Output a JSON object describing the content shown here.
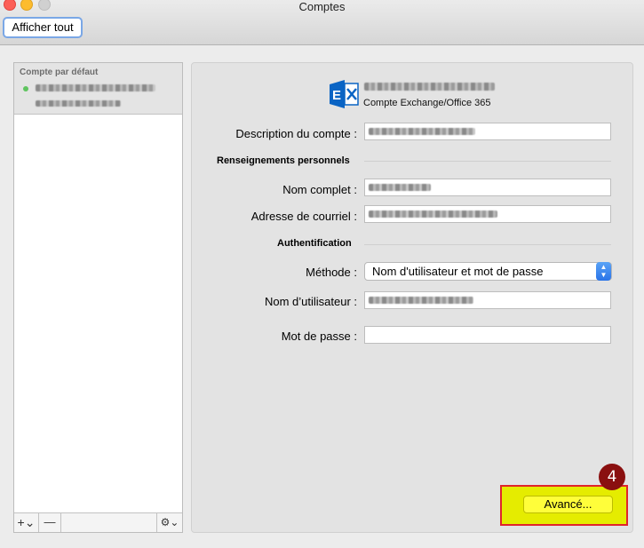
{
  "window": {
    "title": "Comptes"
  },
  "toolbar": {
    "show_all_label": "Afficher tout"
  },
  "sidebar": {
    "section_header": "Compte par défaut",
    "account_status_color": "#5fc45f",
    "add_label": "+⌄",
    "remove_label": "—",
    "gear_label": "⚙⌄"
  },
  "account": {
    "type_label": "Compte Exchange/Office 365",
    "icon": "exchange-icon"
  },
  "form": {
    "description_label": "Description du compte :",
    "personal_section": "Renseignements personnels",
    "full_name_label": "Nom complet :",
    "email_label": "Adresse de courriel :",
    "auth_section": "Authentification",
    "method_label": "Méthode :",
    "method_value": "Nom d'utilisateur et mot de passe",
    "username_label": "Nom d’utilisateur :",
    "password_label": "Mot de passe :",
    "password_value": ""
  },
  "footer": {
    "advanced_label": "Avancé..."
  },
  "annotation": {
    "step_number": "4",
    "highlight_color": "#e5ec00"
  }
}
